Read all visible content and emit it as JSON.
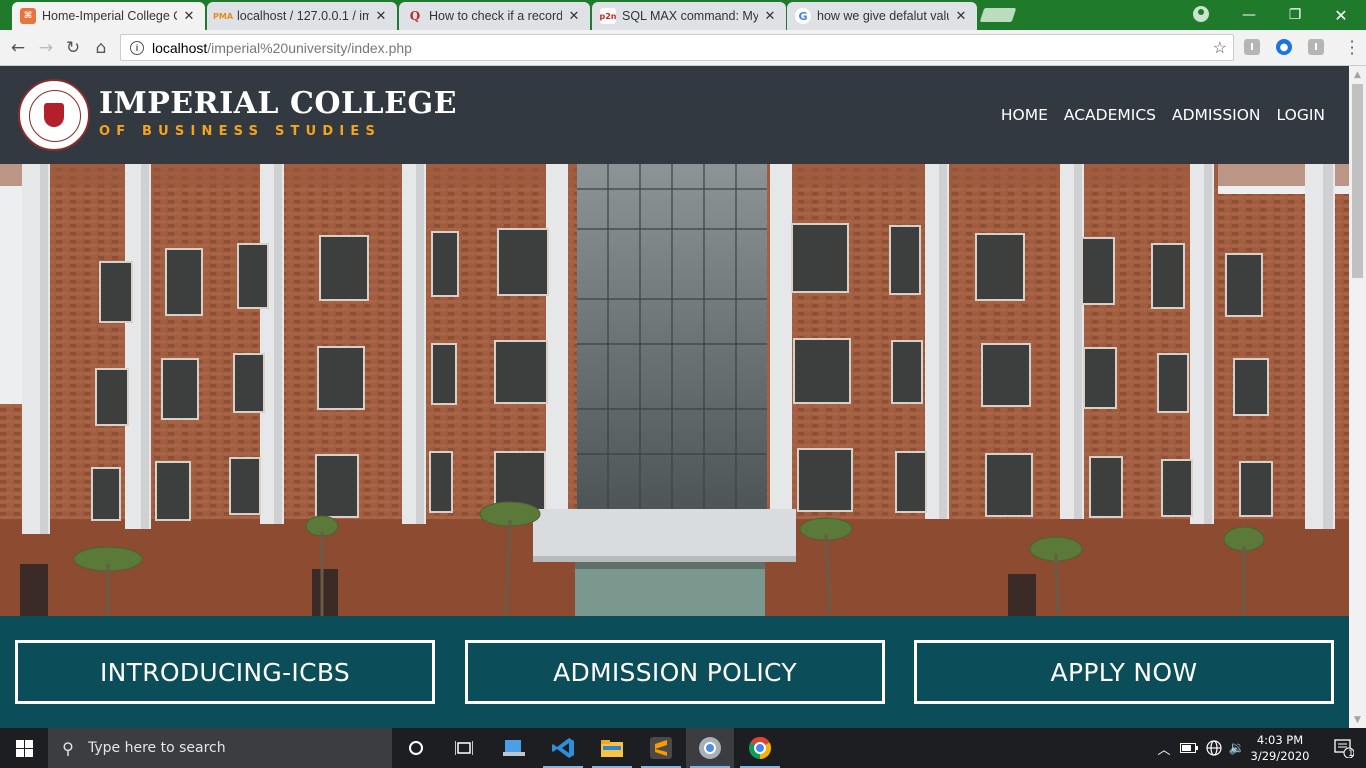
{
  "browser": {
    "tabs": [
      {
        "title": "Home-Imperial College O",
        "icon": "site-favicon",
        "active": true
      },
      {
        "title": "localhost / 127.0.0.1 / im",
        "icon": "phpmyadmin-favicon",
        "active": false
      },
      {
        "title": "How to check if a record",
        "icon": "quora-favicon",
        "active": false
      },
      {
        "title": "SQL MAX command: My",
        "icon": "plus2net-favicon",
        "active": false
      },
      {
        "title": "how we give defalut valu",
        "icon": "google-favicon",
        "active": false
      }
    ],
    "address": {
      "host": "localhost",
      "path": "/imperial%20university/index.php"
    }
  },
  "site": {
    "brand": {
      "name": "IMPERIAL COLLEGE",
      "tagline": "OF BUSINESS STUDIES"
    },
    "nav": [
      "HOME",
      "ACADEMICS",
      "ADMISSION",
      "LOGIN"
    ],
    "features": [
      "INTRODUCING-ICBS",
      "ADMISSION POLICY",
      "APPLY NOW"
    ],
    "colors": {
      "header": "#333941",
      "feature_bar": "#0b4e5a",
      "tagline": "#f4a41c"
    }
  },
  "taskbar": {
    "search_placeholder": "Type here to search",
    "time": "4:03 PM",
    "date": "3/29/2020",
    "notification_count": "1"
  }
}
